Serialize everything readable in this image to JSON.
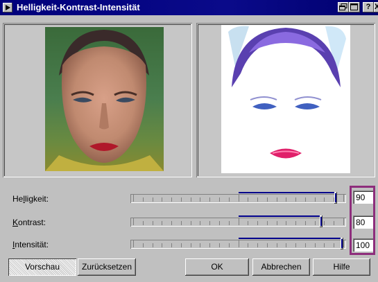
{
  "window": {
    "title": "Helligkeit-Kontrast-Intensität",
    "help_button": "?",
    "close_button": "X"
  },
  "preview": {
    "original_alt": "original image preview",
    "result_alt": "adjusted image preview"
  },
  "sliders": [
    {
      "label_pre": "He",
      "label_key": "l",
      "label_post": "ligkeit:",
      "value": "90",
      "position": 0.97
    },
    {
      "label_pre": "",
      "label_key": "K",
      "label_post": "ontrast:",
      "value": "80",
      "position": 0.9
    },
    {
      "label_pre": "",
      "label_key": "I",
      "label_post": "ntensität:",
      "value": "100",
      "position": 1.0
    }
  ],
  "buttons": {
    "preview": "Vorschau",
    "reset": "Zurücksetzen",
    "ok": "OK",
    "cancel": "Abbrechen",
    "help": "Hilfe"
  },
  "colors": {
    "titlebar": "#00007b",
    "slider_fill": "#00008b",
    "highlight": "#8e2d7c"
  }
}
